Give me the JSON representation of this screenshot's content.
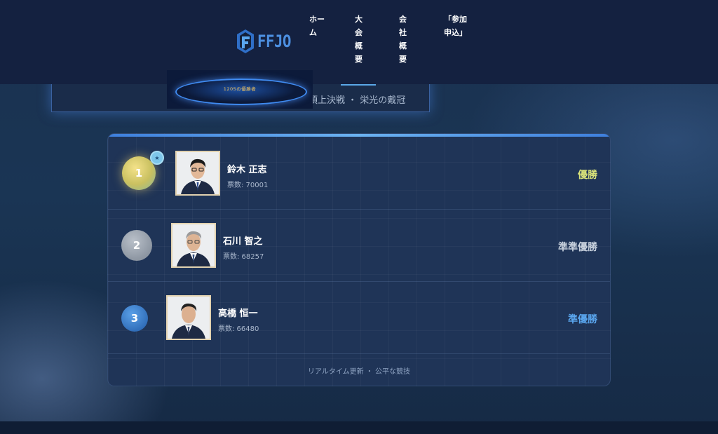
{
  "header": {
    "logo_text": "FFJO",
    "nav": [
      {
        "label": "ホーム"
      },
      {
        "label": "大会概要"
      },
      {
        "label": "会社概要"
      },
      {
        "label": "「参加申込」"
      }
    ]
  },
  "hero": {
    "image_caption": "1205の優勝者",
    "subtitle": "頂上決戦 ・ 栄光の戴冠"
  },
  "ranking": {
    "entries": [
      {
        "rank": "1",
        "name": "鈴木 正志",
        "votes": "票数: 70001",
        "award": "優勝",
        "award_color": "#d8e27a"
      },
      {
        "rank": "2",
        "name": "石川 智之",
        "votes": "票数: 68257",
        "award": "準準優勝",
        "award_color": "#c9d2de"
      },
      {
        "rank": "3",
        "name": "高橋 恒一",
        "votes": "票数: 66480",
        "award": "準優勝",
        "award_color": "#5aa6ee"
      }
    ],
    "footer": "リアルタイム更新 ・ 公平な競技"
  },
  "colors": {
    "accent": "#3e7fdc",
    "background": "#1a3554"
  },
  "icons": [
    "logo-mark-icon",
    "star-badge-icon"
  ]
}
